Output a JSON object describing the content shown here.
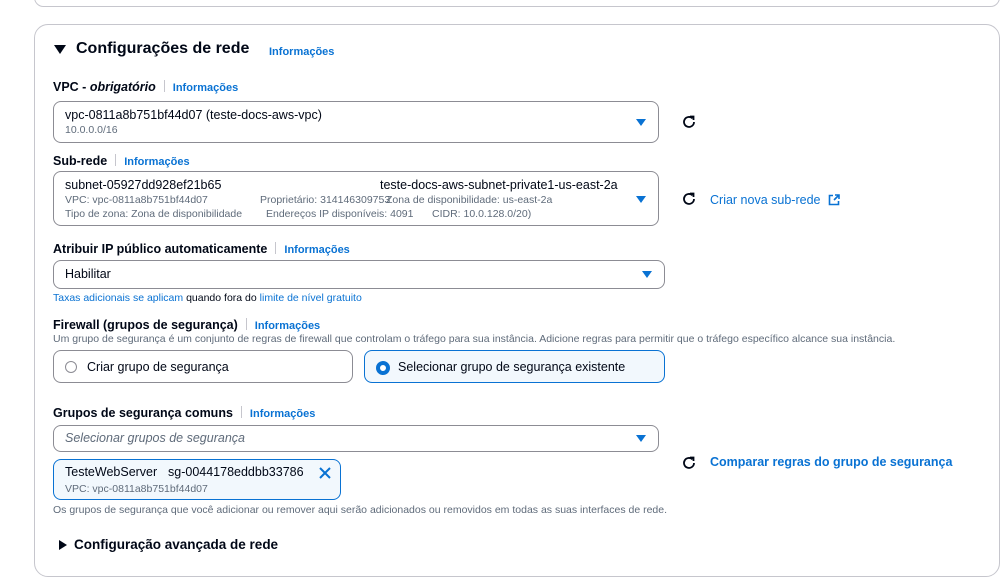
{
  "section": {
    "title": "Configurações de rede",
    "info": "Informações"
  },
  "vpc": {
    "label": "VPC",
    "label_suffix": "obrigatório",
    "info": "Informações",
    "value": "vpc-0811a8b751bf44d07 (teste-docs-aws-vpc)",
    "cidr": "10.0.0.0/16"
  },
  "subnet": {
    "label": "Sub-rede",
    "info": "Informações",
    "id": "subnet-05927dd928ef21b65",
    "name": "teste-docs-aws-subnet-private1-us-east-2a",
    "vpc": "VPC: vpc-0811a8b751bf44d07",
    "owner": "Proprietário: 314146309753",
    "az": "Zona de disponibilidade: us-east-2a",
    "zone_type": "Tipo de zona: Zona de disponibilidade",
    "ips": "Endereços IP disponíveis: 4091",
    "cidr": "CIDR: 10.0.128.0/20)",
    "create_link": "Criar nova sub-rede"
  },
  "public_ip": {
    "label": "Atribuir IP público automaticamente",
    "info": "Informações",
    "value": "Habilitar",
    "note_link1": "Taxas adicionais se aplicam",
    "note_mid": "quando fora do",
    "note_link2": "limite de nível gratuito"
  },
  "firewall": {
    "label": "Firewall (grupos de segurança)",
    "info": "Informações",
    "description": "Um grupo de segurança é um conjunto de regras de firewall que controlam o tráfego para sua instância. Adicione regras para permitir que o tráfego específico alcance sua instância.",
    "option_create": "Criar grupo de segurança",
    "option_select": "Selecionar grupo de segurança existente",
    "selected": "select"
  },
  "common_groups": {
    "label": "Grupos de segurança comuns",
    "info": "Informações",
    "placeholder": "Selecionar grupos de segurança",
    "token_name": "TesteWebServer",
    "token_id": "sg-0044178eddbb33786",
    "token_vpc": "VPC: vpc-0811a8b751bf44d07",
    "compare_link": "Comparar regras do grupo de segurança",
    "note": "Os grupos de segurança que você adicionar ou remover aqui serão adicionados ou removidos em todas as suas interfaces de rede."
  },
  "advanced": {
    "label": "Configuração avançada de rede"
  },
  "colors": {
    "link": "#0972d3",
    "border": "#8c8c94",
    "text": "#000716",
    "muted": "#5f6b7a"
  }
}
